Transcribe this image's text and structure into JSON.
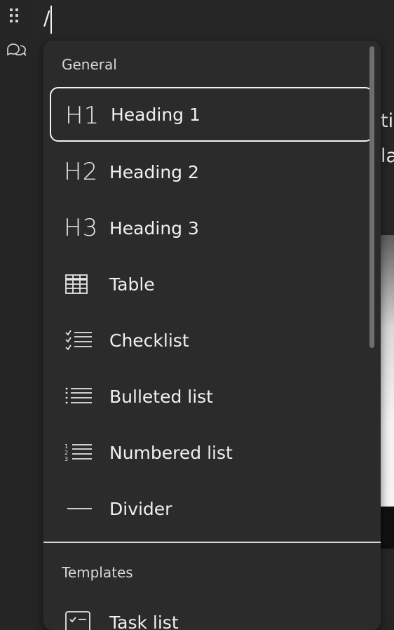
{
  "editor": {
    "slash_input": "/",
    "background_lines": [
      "ti",
      "la"
    ]
  },
  "menu": {
    "general_label": "General",
    "templates_label": "Templates",
    "items": [
      {
        "label": "Heading 1",
        "icon": "heading-1-icon",
        "glyph": "H1",
        "selected": true
      },
      {
        "label": "Heading 2",
        "icon": "heading-2-icon",
        "glyph": "H2",
        "selected": false
      },
      {
        "label": "Heading 3",
        "icon": "heading-3-icon",
        "glyph": "H3",
        "selected": false
      },
      {
        "label": "Table",
        "icon": "table-icon",
        "selected": false
      },
      {
        "label": "Checklist",
        "icon": "checklist-icon",
        "selected": false
      },
      {
        "label": "Bulleted list",
        "icon": "bulleted-list-icon",
        "selected": false
      },
      {
        "label": "Numbered list",
        "icon": "numbered-list-icon",
        "selected": false
      },
      {
        "label": "Divider",
        "icon": "divider-icon",
        "selected": false
      }
    ],
    "template_items": [
      {
        "label": "Task list",
        "icon": "task-list-icon"
      }
    ]
  },
  "colors": {
    "background": "#252525",
    "menu_background": "#2b2b2b",
    "selection_border": "#f2f2f2",
    "text": "#f0f0f0"
  }
}
